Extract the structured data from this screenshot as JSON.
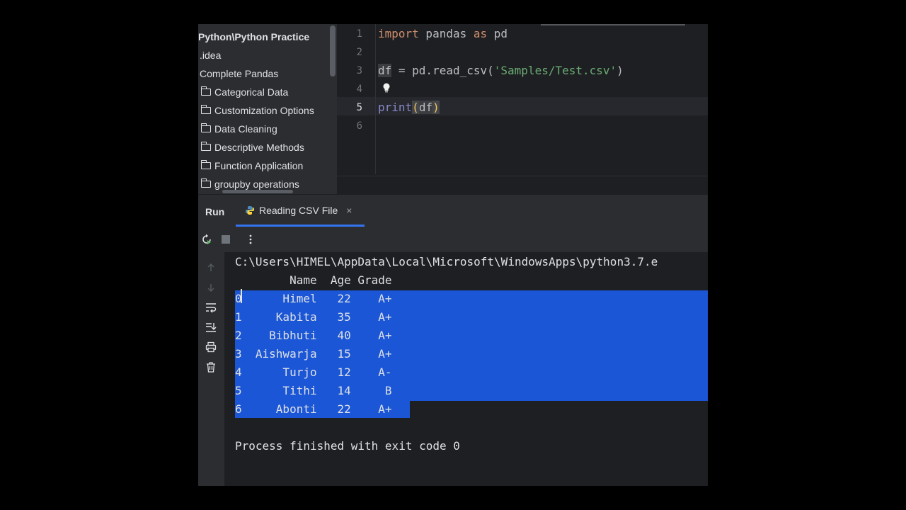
{
  "project_tree": {
    "root": "Python\\Python Practice",
    "items": [
      {
        "label": ".idea",
        "folder": false
      },
      {
        "label": "Complete Pandas",
        "folder": false
      },
      {
        "label": "Categorical Data",
        "folder": true
      },
      {
        "label": "Customization Options",
        "folder": true
      },
      {
        "label": "Data Cleaning",
        "folder": true
      },
      {
        "label": "Descriptive Methods",
        "folder": true
      },
      {
        "label": "Function Application",
        "folder": true
      },
      {
        "label": "groupby operations",
        "folder": true
      }
    ]
  },
  "editor": {
    "line_numbers": [
      "1",
      "2",
      "3",
      "4",
      "5",
      "6"
    ],
    "active_line": "5",
    "line1": {
      "kw_import": "import",
      "mod": " pandas ",
      "kw_as": "as",
      "alias": " pd"
    },
    "line3": {
      "var": "df",
      "rest": " = pd.read_csv(",
      "str": "'Samples/Test.csv'",
      "close": ")"
    },
    "line5": {
      "fn": "print",
      "open": "(",
      "arg": "df",
      "close": ")"
    }
  },
  "run_panel": {
    "title": "Run",
    "tab_label": "Reading CSV File",
    "tab_close": "×"
  },
  "console": {
    "path": "C:\\Users\\HIMEL\\AppData\\Local\\Microsoft\\WindowsApps\\python3.7.e",
    "header": "        Name  Age Grade",
    "rows": [
      "0      Himel   22    A+",
      "1     Kabita   35    A+",
      "2    Bibhuti   40    A+",
      "3  Aishwarja   15    A+",
      "4      Turjo   12    A-",
      "5      Tithi   14     B",
      "6     Abonti   22    A+"
    ],
    "exit_message": "Process finished with exit code 0"
  }
}
